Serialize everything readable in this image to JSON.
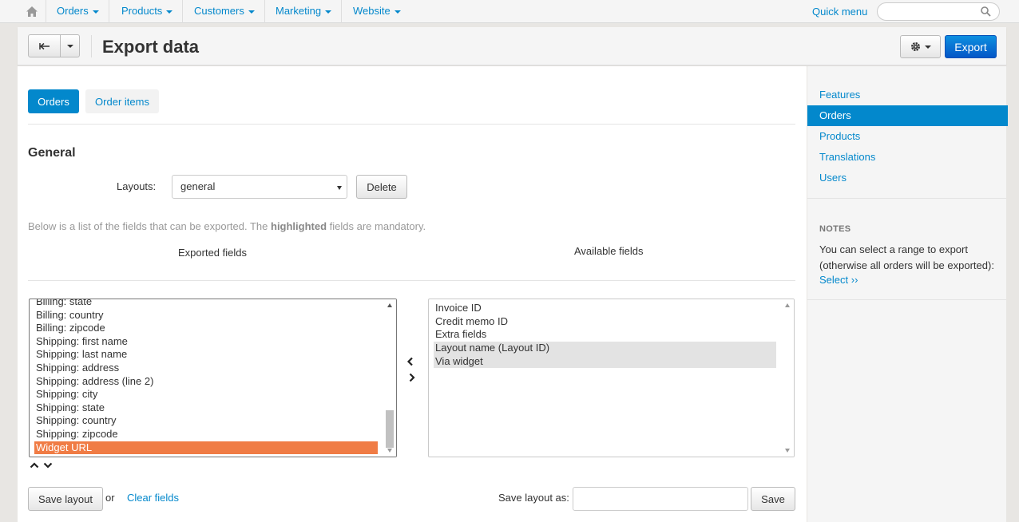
{
  "nav": {
    "items": [
      {
        "label": "Orders",
        "name": "nav-orders"
      },
      {
        "label": "Products",
        "name": "nav-products"
      },
      {
        "label": "Customers",
        "name": "nav-customers"
      },
      {
        "label": "Marketing",
        "name": "nav-marketing"
      },
      {
        "label": "Website",
        "name": "nav-website"
      }
    ],
    "quick_menu": "Quick menu",
    "search_placeholder": ""
  },
  "header": {
    "title": "Export data",
    "export_label": "Export"
  },
  "tabs": [
    {
      "label": "Orders",
      "active": true
    },
    {
      "label": "Order items",
      "active": false
    }
  ],
  "general": {
    "title": "General",
    "layouts_label": "Layouts:",
    "layout_selected": "general",
    "delete_label": "Delete",
    "help_prefix": "Below is a list of the fields that can be exported. The ",
    "help_bold": "highlighted",
    "help_suffix": " fields are mandatory.",
    "exported_label": "Exported fields",
    "available_label": "Available fields"
  },
  "exported_fields": [
    "Billing: state",
    "Billing: country",
    "Billing: zipcode",
    "Shipping: first name",
    "Shipping: last name",
    "Shipping: address",
    "Shipping: address (line 2)",
    "Shipping: city",
    "Shipping: state",
    "Shipping: country",
    "Shipping: zipcode",
    "Widget URL"
  ],
  "available_fields": [
    "Invoice ID",
    "Credit memo ID",
    "Extra fields",
    "Layout name (Layout ID)",
    "Via widget"
  ],
  "footer": {
    "save_layout": "Save layout",
    "or": "or",
    "clear_fields": "Clear fields",
    "save_as_label": "Save layout as:",
    "save_as_value": "",
    "save": "Save"
  },
  "sidebar": {
    "items": [
      {
        "label": "Features",
        "active": false
      },
      {
        "label": "Orders",
        "active": true
      },
      {
        "label": "Products",
        "active": false
      },
      {
        "label": "Translations",
        "active": false
      },
      {
        "label": "Users",
        "active": false
      }
    ],
    "notes_title": "NOTES",
    "notes_text": "You can select a range to export (otherwise all orders will be exported):",
    "notes_link": "Select ››"
  },
  "colors": {
    "accent": "#0388cc",
    "export_button": "#0457c7",
    "selected_mandatory": "#f07c45",
    "selected_available": "#e3e3e3"
  }
}
